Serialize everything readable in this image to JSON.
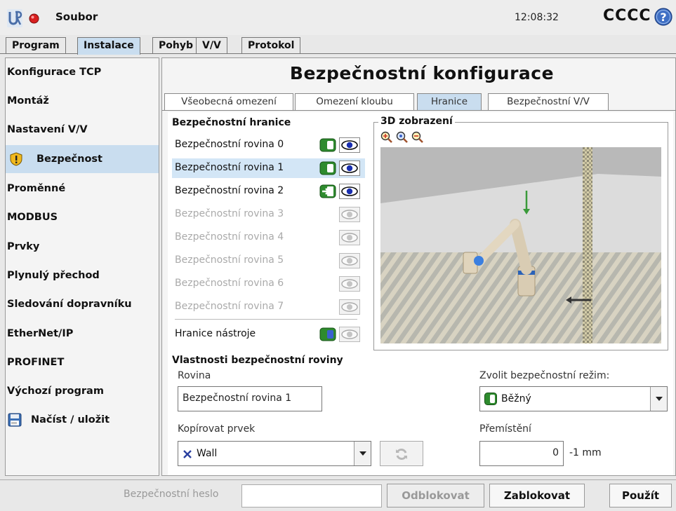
{
  "header": {
    "app_menu": "Soubor",
    "time": "12:08:32",
    "robot_name": "CCCC"
  },
  "main_tabs": [
    "Program",
    "Instalace",
    "Pohyb",
    "V/V",
    "Protokol"
  ],
  "sidebar": {
    "items": [
      "Konfigurace TCP",
      "Montáž",
      "Nastavení V/V",
      "Bezpečnost",
      "Proměnné",
      "MODBUS",
      "Prvky",
      "Plynulý přechod",
      "Sledování dopravníku",
      "EtherNet/IP",
      "PROFINET",
      "Výchozí program",
      "Načíst / uložit"
    ]
  },
  "main": {
    "title": "Bezpečnostní konfigurace",
    "sub_tabs": [
      "Všeobecná omezení",
      "Omezení kloubu",
      "Hranice",
      "Bezpečnostní V/V"
    ],
    "boundaries_title": "Bezpečnostní hranice",
    "planes": [
      "Bezpečnostní rovina 0",
      "Bezpečnostní rovina 1",
      "Bezpečnostní rovina 2",
      "Bezpečnostní rovina 3",
      "Bezpečnostní rovina 4",
      "Bezpečnostní rovina 5",
      "Bezpečnostní rovina 6",
      "Bezpečnostní rovina 7"
    ],
    "tool_boundary": "Hranice nástroje",
    "view_title": "3D zobrazení",
    "properties_title": "Vlastnosti bezpečnostní roviny",
    "plane_label": "Rovina",
    "plane_value": "Bezpečnostní rovina 1",
    "copy_label": "Kopírovat prvek",
    "copy_value": "Wall",
    "mode_label": "Zvolit bezpečnostní režim:",
    "mode_value": "Běžný",
    "displacement_label": "Přemístění",
    "displacement_value": "0",
    "displacement_unit": "-1 mm"
  },
  "footer": {
    "password_label": "Bezpečnostní heslo",
    "password_value": "",
    "unlock": "Odblokovat",
    "lock": "Zablokovat",
    "apply": "Použít"
  },
  "colors": {
    "active_tab": "#c9ddef",
    "selected_row": "#d3e6f6",
    "normal_mode_green": "#2e8b2e",
    "eye_blue": "#1a2fb0"
  }
}
